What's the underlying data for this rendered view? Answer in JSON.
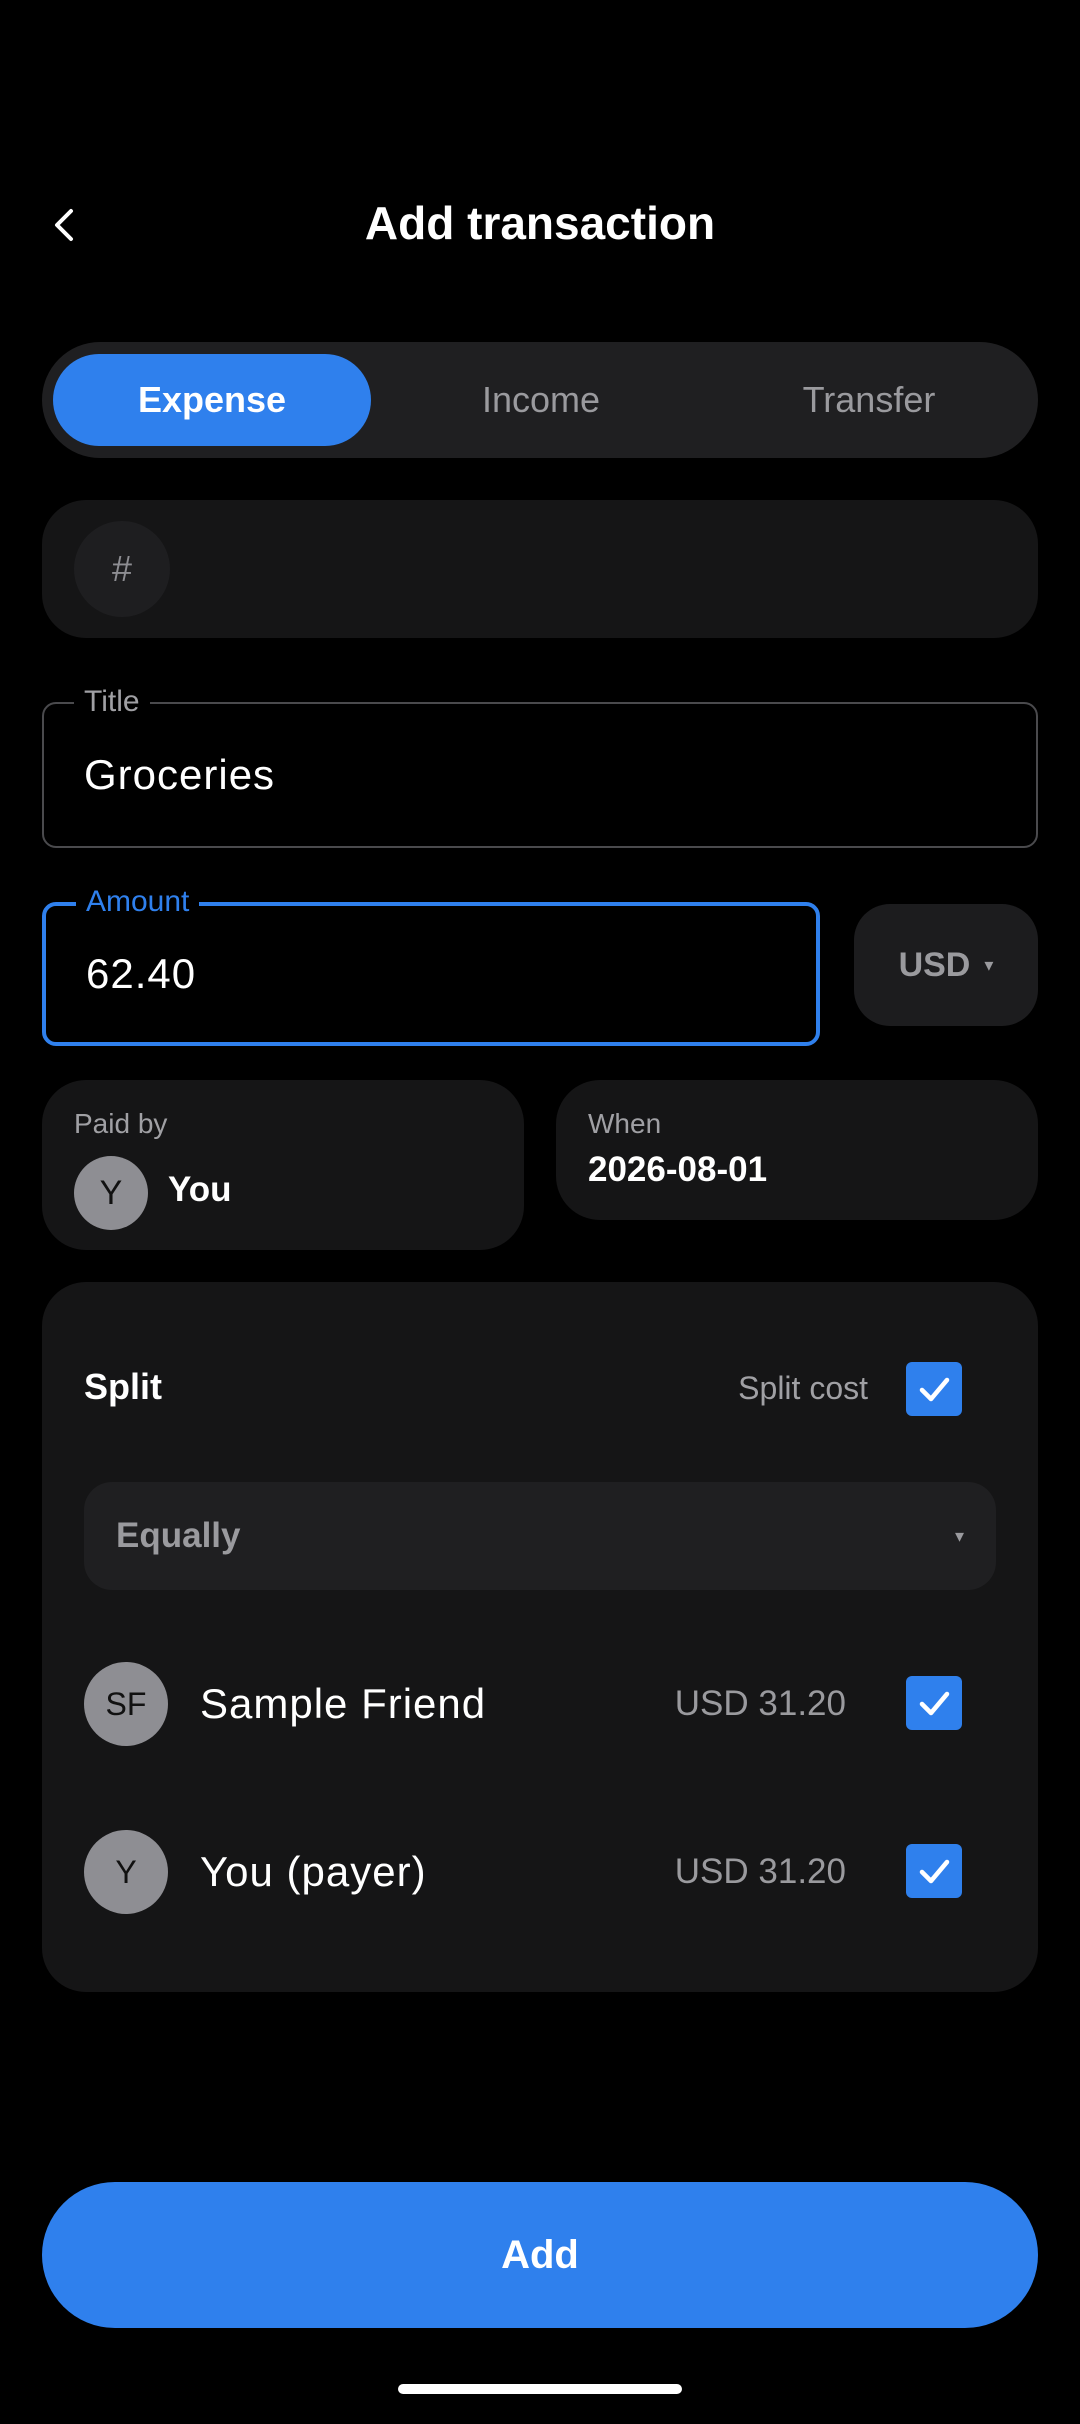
{
  "header": {
    "back_icon": "chevron-left-icon",
    "title": "Add transaction"
  },
  "type_tabs": [
    {
      "label": "Expense",
      "active": true
    },
    {
      "label": "Income",
      "active": false
    },
    {
      "label": "Transfer",
      "active": false
    }
  ],
  "category": {
    "icon_glyph": "#"
  },
  "title_field": {
    "label": "Title",
    "value": "Groceries"
  },
  "amount_field": {
    "label": "Amount",
    "value": "62.40"
  },
  "currency": {
    "value": "USD",
    "caret": "▾"
  },
  "paid_by": {
    "label": "Paid by",
    "avatar_initial": "Y",
    "name": "You"
  },
  "when": {
    "label": "When",
    "value": "2026-08-01"
  },
  "split": {
    "title": "Split",
    "split_cost_label": "Split cost",
    "split_cost_checked": true,
    "method": "Equally",
    "method_caret": "▾",
    "members": [
      {
        "initials": "SF",
        "name": "Sample Friend",
        "amount": "USD 31.20",
        "checked": true
      },
      {
        "initials": "Y",
        "name": "You (payer)",
        "amount": "USD 31.20",
        "checked": true
      }
    ]
  },
  "add_button": {
    "label": "Add"
  },
  "colors": {
    "accent": "#2f80ed",
    "background": "#000000",
    "card": "#151516"
  }
}
